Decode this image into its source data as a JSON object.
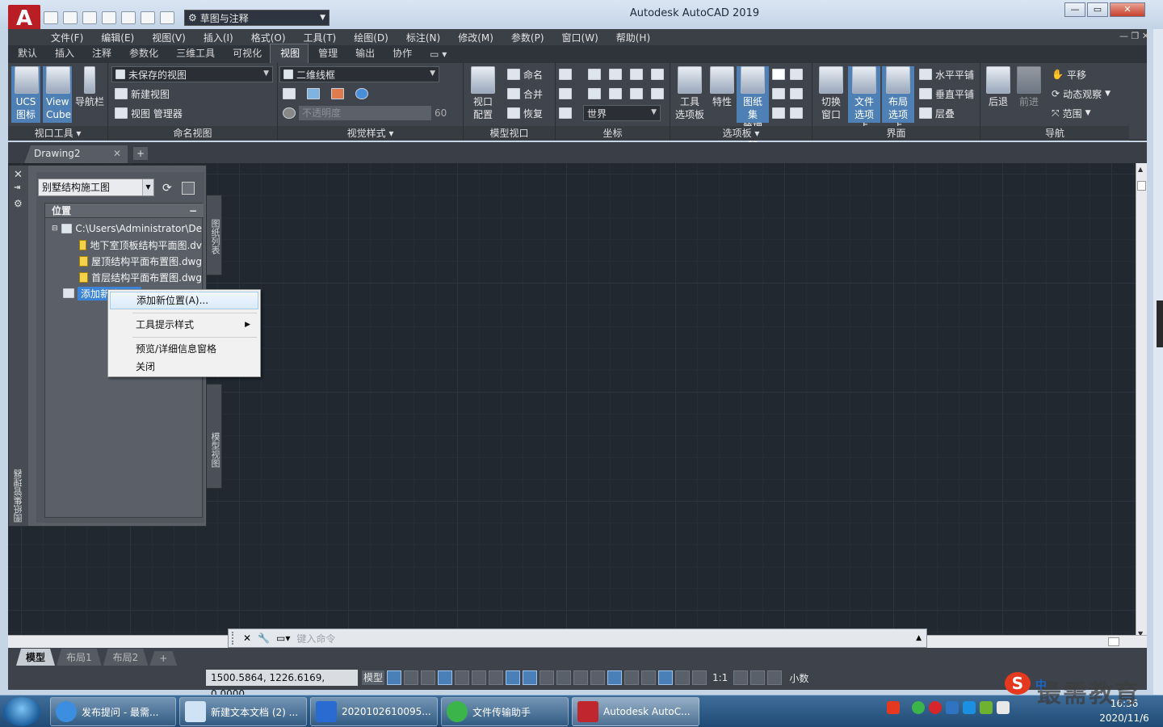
{
  "app": {
    "title": "Autodesk AutoCAD 2019",
    "logo_letter": "A",
    "workspace": "草图与注释"
  },
  "menubar": [
    "文件(F)",
    "编辑(E)",
    "视图(V)",
    "插入(I)",
    "格式(O)",
    "工具(T)",
    "绘图(D)",
    "标注(N)",
    "修改(M)",
    "参数(P)",
    "窗口(W)",
    "帮助(H)"
  ],
  "ribbon_tabs": [
    "默认",
    "插入",
    "注释",
    "参数化",
    "三维工具",
    "可视化",
    "视图",
    "管理",
    "输出",
    "协作"
  ],
  "ribbon_active_tab": "视图",
  "ribbon": {
    "viewport_tools": {
      "label": "视口工具",
      "ucs_l1": "UCS",
      "ucs_l2": "图标",
      "viewcube_l1": "View",
      "viewcube_l2": "Cube",
      "navbar": "导航栏"
    },
    "named_views": {
      "label": "命名视图",
      "combo": "未保存的视图",
      "new_view": "新建视图",
      "view_manager": "视图 管理器"
    },
    "visual_styles": {
      "label": "视觉样式",
      "combo": "二维线框",
      "opacity_placeholder": "不透明度",
      "opacity_value": "60"
    },
    "model_viewports": {
      "label": "模型视口",
      "config_l1": "视口",
      "config_l2": "配置",
      "name": "命名",
      "join": "合并",
      "restore": "恢复"
    },
    "coordinates": {
      "label": "坐标",
      "world": "世界"
    },
    "palettes": {
      "label": "选项板",
      "tool_l1": "工具",
      "tool_l2": "选项板",
      "properties": "特性",
      "sheetset_l1": "图纸集",
      "sheetset_l2": "管理器"
    },
    "interface": {
      "label": "界面",
      "switch_l1": "切换",
      "switch_l2": "窗口",
      "filetab_l1": "文件",
      "filetab_l2": "选项卡",
      "layouttab_l1": "布局",
      "layouttab_l2": "选项卡",
      "tile_h": "水平平铺",
      "tile_v": "垂直平铺",
      "cascade": "层叠"
    },
    "navigate": {
      "label": "导航",
      "back": "后退",
      "forward": "前进",
      "pan": "平移",
      "orbit": "动态观察",
      "extents": "范围"
    }
  },
  "document": {
    "tab": "Drawing2"
  },
  "sheet_set_manager": {
    "title": "图纸集管理器",
    "combo": "别墅结构施工图",
    "side_tabs": [
      "图纸列表",
      "模型视图"
    ],
    "section_header": "位置",
    "tree": [
      "C:\\Users\\Administrator\\De",
      "地下室顶板结构平面图.dv",
      "屋顶结构平面布置图.dwg",
      "首层结构平面布置图.dwg"
    ],
    "add_location": "添加新位置..."
  },
  "context_menu": {
    "items": [
      "添加新位置(A)...",
      "工具提示样式",
      "预览/详细信息窗格",
      "关闭"
    ]
  },
  "command_line": {
    "placeholder": "键入命令"
  },
  "layout_tabs": [
    "模型",
    "布局1",
    "布局2"
  ],
  "status_bar": {
    "coords": "1500.5864, 1226.6169, 0.0000",
    "model": "模型",
    "scale": "1:1",
    "units": "小数"
  },
  "taskbar": {
    "items": [
      "发布提问 - 最需...",
      "新建文本文档 (2) ...",
      "2020102610095...",
      "文件传输助手",
      "Autodesk AutoC..."
    ],
    "time": "16:36",
    "date": "2020/11/6"
  },
  "watermark": {
    "text": "最需教育",
    "logo": "S"
  },
  "ime": "中"
}
